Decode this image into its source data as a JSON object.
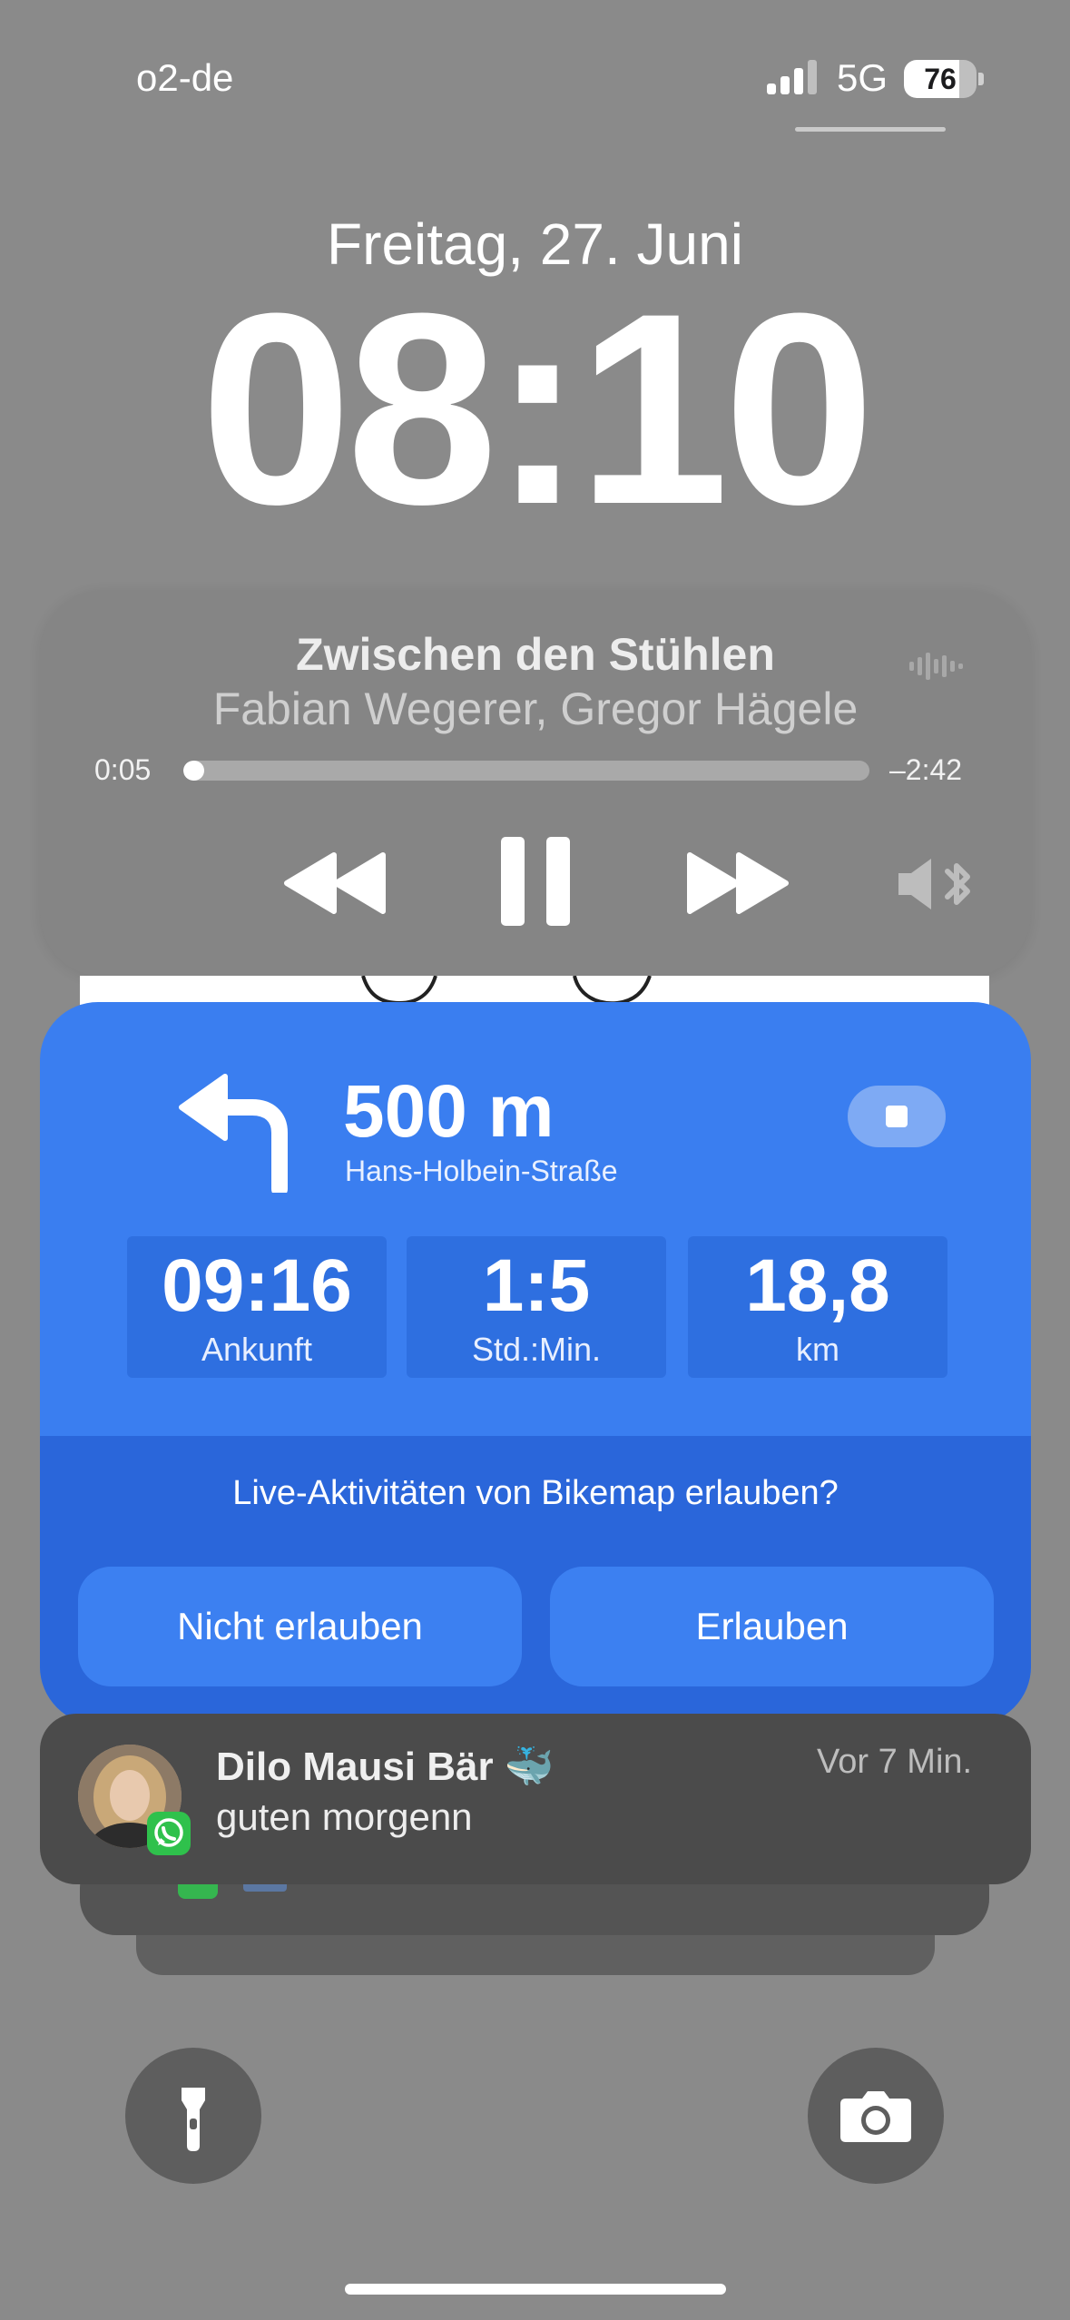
{
  "status_bar": {
    "carrier": "o2-de",
    "network": "5G",
    "battery_percent": "76",
    "battery_level": 0.76
  },
  "lock_screen": {
    "date": "Freitag, 27. Juni",
    "time": "08:10"
  },
  "now_playing": {
    "title": "Zwischen den Stühlen",
    "artist": "Fabian Wegerer, Gregor Hägele",
    "elapsed": "0:05",
    "remaining": "–2:42",
    "progress": 0.03
  },
  "navigation": {
    "distance": "500 m",
    "street": "Hans-Holbein-Straße",
    "stats": [
      {
        "value": "09:16",
        "label": "Ankunft"
      },
      {
        "value": "1:5",
        "label": "Std.:Min."
      },
      {
        "value": "18,8",
        "label": "km"
      }
    ],
    "prompt": "Live-Aktivitäten von Bikemap erlauben?",
    "deny_label": "Nicht erlauben",
    "allow_label": "Erlauben"
  },
  "notification": {
    "sender": "Dilo Mausi Bär 🐳",
    "message": "guten morgenn",
    "time": "Vor 7 Min.",
    "app_icon": "whatsapp-icon"
  },
  "colors": {
    "nav_blue": "#3a7ef0",
    "whatsapp_green": "#2fc14c"
  }
}
